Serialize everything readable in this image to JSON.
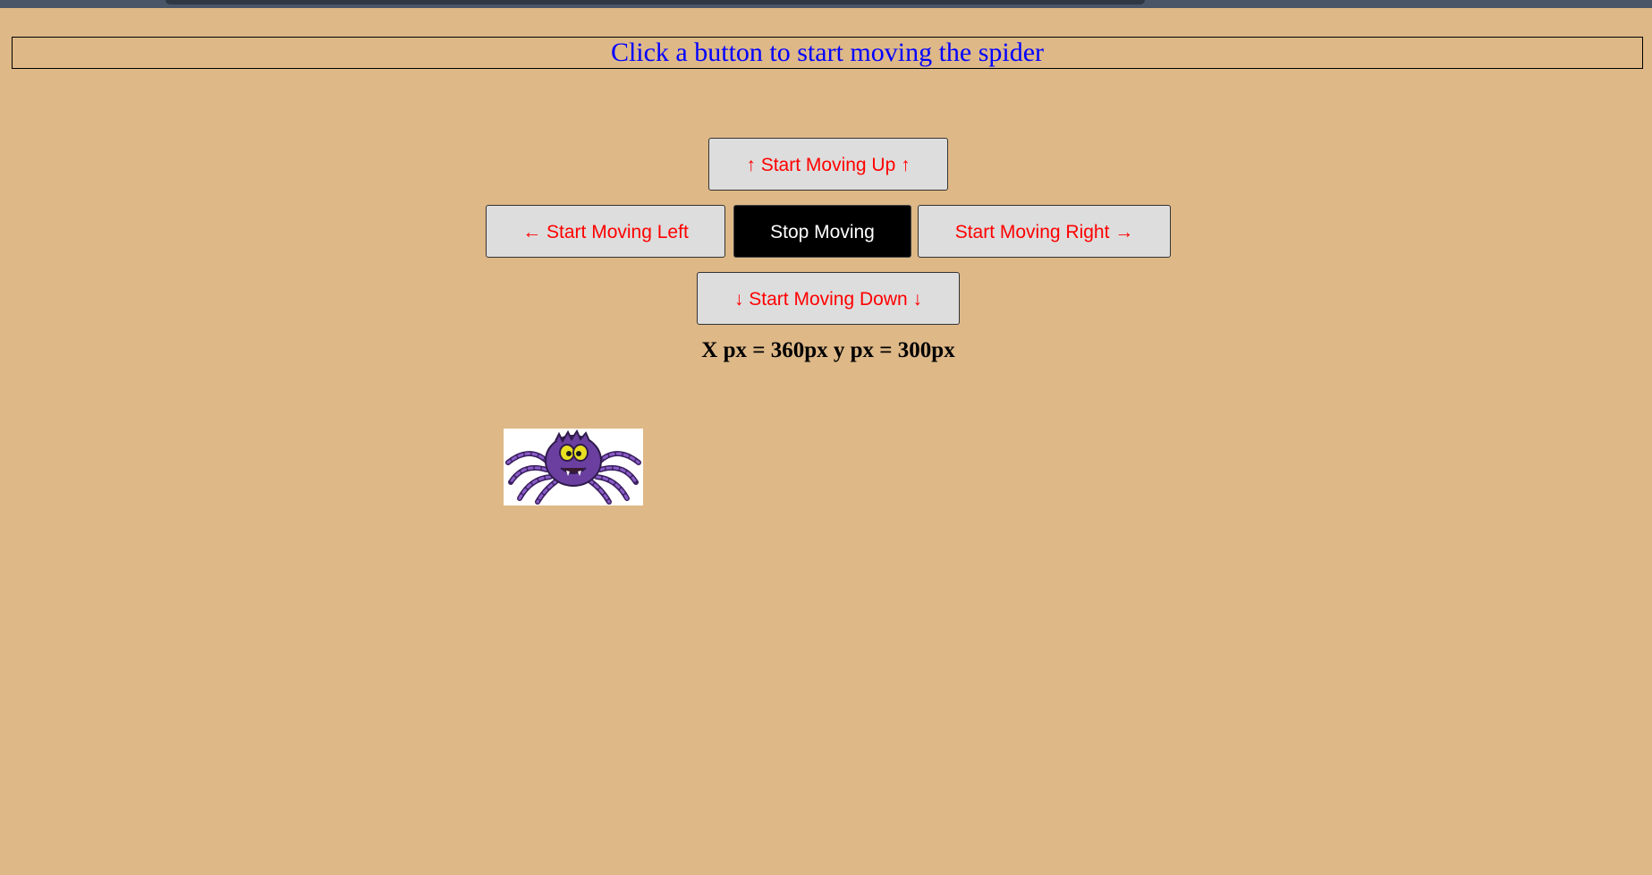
{
  "header": {
    "instruction": "Click a button to start moving the spider"
  },
  "controls": {
    "up_label": "↑ Start Moving Up ↑",
    "left_label": "← Start Moving Left",
    "stop_label": "Stop Moving",
    "right_label": "Start Moving Right →",
    "down_label": "↓ Start Moving Down ↓"
  },
  "status": {
    "coords_text": "X px = 360px y px = 300px"
  },
  "spider": {
    "icon": "spider-icon",
    "body_color": "#6b3fa0",
    "eye_color": "#e8e020"
  },
  "colors": {
    "background": "#deb887",
    "headline": "#0000ff",
    "button_text": "#ff0000",
    "stop_bg": "#000000",
    "stop_text": "#ffffff"
  }
}
